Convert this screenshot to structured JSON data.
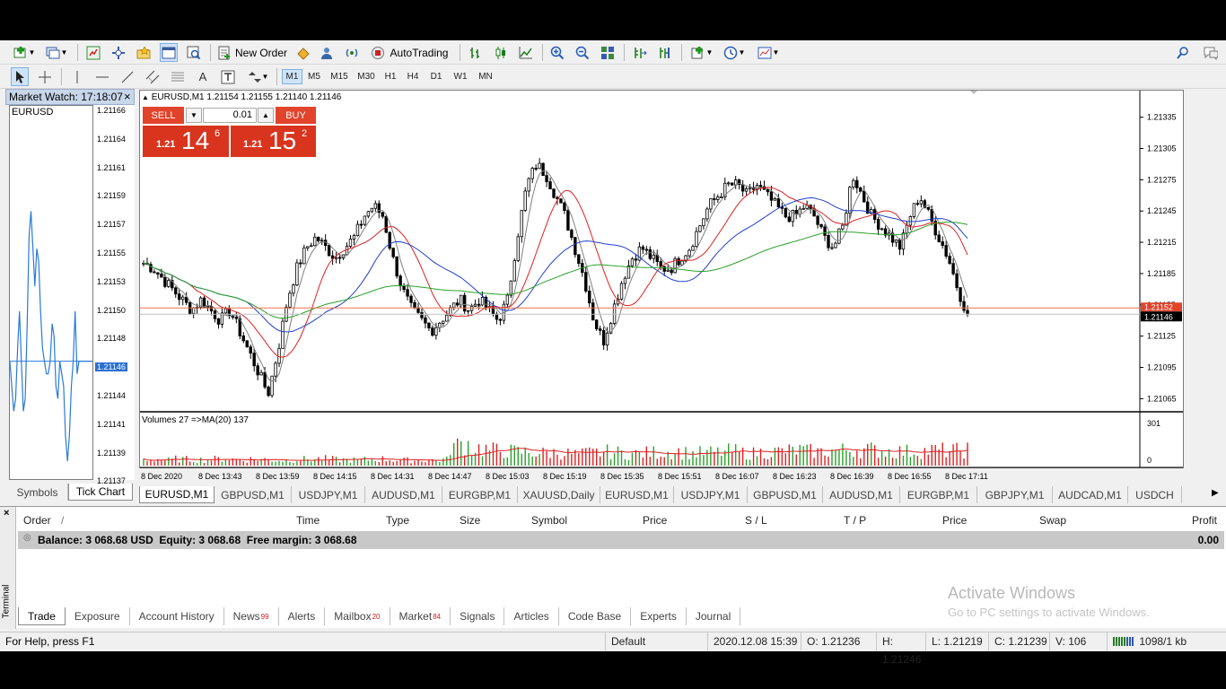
{
  "toolbar": {
    "new_order": "New Order",
    "autotrading": "AutoTrading",
    "timeframes": [
      "M1",
      "M5",
      "M15",
      "M30",
      "H1",
      "H4",
      "D1",
      "W1",
      "MN"
    ],
    "active_timeframe": "M1"
  },
  "market_watch": {
    "title": "Market Watch: 17:18:07",
    "symbol": "EURUSD",
    "tabs": [
      "Symbols",
      "Tick Chart"
    ],
    "price_labels": [
      "1.21166",
      "1.21164",
      "1.21161",
      "1.21159",
      "1.21157",
      "1.21155",
      "1.21153",
      "1.21150",
      "1.21148",
      "1.21146",
      "1.21144",
      "1.21141",
      "1.21139",
      "1.21137"
    ],
    "current_price": "1.21146",
    "tick_series": [
      1.21146,
      1.21144,
      1.21142,
      1.21143,
      1.21147,
      1.2115,
      1.21146,
      1.21142,
      1.21143,
      1.21149,
      1.21156,
      1.21158,
      1.21155,
      1.21152,
      1.21155,
      1.21154,
      1.2115,
      1.21147,
      1.21146,
      1.21145,
      1.21145,
      1.21146,
      1.21149,
      1.21148,
      1.21144,
      1.21143,
      1.21146,
      1.21145,
      1.21144,
      1.2114,
      1.21138,
      1.2114,
      1.21144,
      1.21146,
      1.2115,
      1.21145,
      1.21146,
      1.21146,
      1.21146,
      1.21146,
      1.21146,
      1.21146,
      1.21146,
      1.21146
    ]
  },
  "chart": {
    "header": "EURUSD,M1  1.21154 1.21155 1.21140 1.21146",
    "one_click": {
      "sell_label": "SELL",
      "buy_label": "BUY",
      "lot": "0.01",
      "sell_price_prefix": "1.21",
      "sell_price_big": "14",
      "sell_price_sup": "6",
      "buy_price_prefix": "1.21",
      "buy_price_big": "15",
      "buy_price_sup": "2"
    },
    "price_axis": [
      "1.21335",
      "1.21305",
      "1.21275",
      "1.21245",
      "1.21215",
      "1.21185",
      "1.21155",
      "1.21125",
      "1.21095",
      "1.21065"
    ],
    "ask_label": "1.21152",
    "bid_label": "1.21146",
    "volume_header": "Volumes 27  =>MA(20) 137",
    "volume_axis": [
      "301",
      "0"
    ],
    "time_axis": [
      "8 Dec 2020",
      "8 Dec 13:43",
      "8 Dec 13:59",
      "8 Dec 14:15",
      "8 Dec 14:31",
      "8 Dec 14:47",
      "8 Dec 15:03",
      "8 Dec 15:19",
      "8 Dec 15:35",
      "8 Dec 15:51",
      "8 Dec 16:07",
      "8 Dec 16:23",
      "8 Dec 16:39",
      "8 Dec 16:55",
      "8 Dec 17:11"
    ],
    "colors": {
      "candle": "#000000",
      "ma_fast": "#808080",
      "ma_red": "#e02020",
      "ma_blue": "#1f3fd0",
      "ma_green": "#2aa02a",
      "vol_up": "#2aa02a",
      "vol_down": "#e02020",
      "ask_line": "#f07050"
    },
    "price_path": [
      1.21195,
      1.2119,
      1.2118,
      1.2117,
      1.2116,
      1.2115,
      1.2116,
      1.2115,
      1.2114,
      1.2115,
      1.2113,
      1.2111,
      1.2109,
      1.2107,
      1.2111,
      1.2116,
      1.2119,
      1.2121,
      1.2122,
      1.2121,
      1.212,
      1.2121,
      1.2122,
      1.2124,
      1.2125,
      1.2124,
      1.212,
      1.2117,
      1.2115,
      1.2114,
      1.2113,
      1.2114,
      1.2115,
      1.2116,
      1.2115,
      1.2116,
      1.2115,
      1.2114,
      1.2116,
      1.2122,
      1.2127,
      1.2129,
      1.2128,
      1.2126,
      1.2124,
      1.2121,
      1.2118,
      1.2114,
      1.2112,
      1.2115,
      1.2118,
      1.212,
      1.2121,
      1.212,
      1.2119,
      1.2119,
      1.212,
      1.2121,
      1.2123,
      1.2125,
      1.2126,
      1.2127,
      1.2127,
      1.2126,
      1.2127,
      1.2126,
      1.2125,
      1.2124,
      1.2124,
      1.2125,
      1.2124,
      1.2122,
      1.2121,
      1.2123,
      1.2128,
      1.2126,
      1.2124,
      1.2123,
      1.2122,
      1.2121,
      1.2124,
      1.2126,
      1.2124,
      1.2122,
      1.212,
      1.2117,
      1.21146
    ],
    "volume_path": [
      55,
      60,
      50,
      62,
      58,
      55,
      52,
      60,
      65,
      58,
      55,
      60,
      58,
      52,
      50,
      55,
      58,
      60,
      62,
      58,
      55,
      52,
      50,
      55,
      60,
      58,
      52,
      50,
      48,
      52,
      50,
      55,
      180,
      200,
      160,
      150,
      140,
      135,
      130,
      125,
      120,
      115,
      118,
      120,
      110,
      105,
      115,
      120,
      125,
      118,
      112,
      108,
      115,
      120,
      125,
      130,
      118,
      112,
      115,
      120,
      125,
      130,
      118,
      112,
      120,
      125,
      130,
      135,
      140,
      130,
      125,
      135,
      140,
      145,
      150,
      145,
      140,
      135,
      130,
      128,
      132,
      135,
      140,
      138,
      135,
      140,
      150
    ]
  },
  "chart_tabs": [
    "EURUSD,M1",
    "GBPUSD,M1",
    "USDJPY,M1",
    "AUDUSD,M1",
    "EURGBP,M1",
    "XAUUSD,Daily",
    "EURUSD,M1",
    "USDJPY,M1",
    "GBPUSD,M1",
    "AUDUSD,M1",
    "EURGBP,M1",
    "GBPJPY,M1",
    "AUDCAD,M1",
    "USDCH"
  ],
  "terminal": {
    "side_label": "Terminal",
    "columns": [
      "Order",
      "Time",
      "Type",
      "Size",
      "Symbol",
      "Price",
      "S / L",
      "T / P",
      "Price",
      "Swap",
      "Profit"
    ],
    "balance_row": "Balance: 3 068.68 USD  Equity: 3 068.68  Free margin: 3 068.68",
    "balance_profit": "0.00",
    "tabs": [
      {
        "label": "Trade",
        "badge": ""
      },
      {
        "label": "Exposure",
        "badge": ""
      },
      {
        "label": "Account History",
        "badge": ""
      },
      {
        "label": "News",
        "badge": "99"
      },
      {
        "label": "Alerts",
        "badge": ""
      },
      {
        "label": "Mailbox",
        "badge": "20"
      },
      {
        "label": "Market",
        "badge": "84"
      },
      {
        "label": "Signals",
        "badge": ""
      },
      {
        "label": "Articles",
        "badge": ""
      },
      {
        "label": "Code Base",
        "badge": ""
      },
      {
        "label": "Experts",
        "badge": ""
      },
      {
        "label": "Journal",
        "badge": ""
      }
    ],
    "watermark_title": "Activate Windows",
    "watermark_sub": "Go to PC settings to activate Windows."
  },
  "status": {
    "help": "For Help, press F1",
    "profile": "Default",
    "datetime": "2020.12.08 15:39",
    "open": "O: 1.21236",
    "high": "H: 1.21246",
    "low": "L: 1.21219",
    "close": "C: 1.21239",
    "volume": "V: 106",
    "traffic": "1098/1 kb"
  }
}
